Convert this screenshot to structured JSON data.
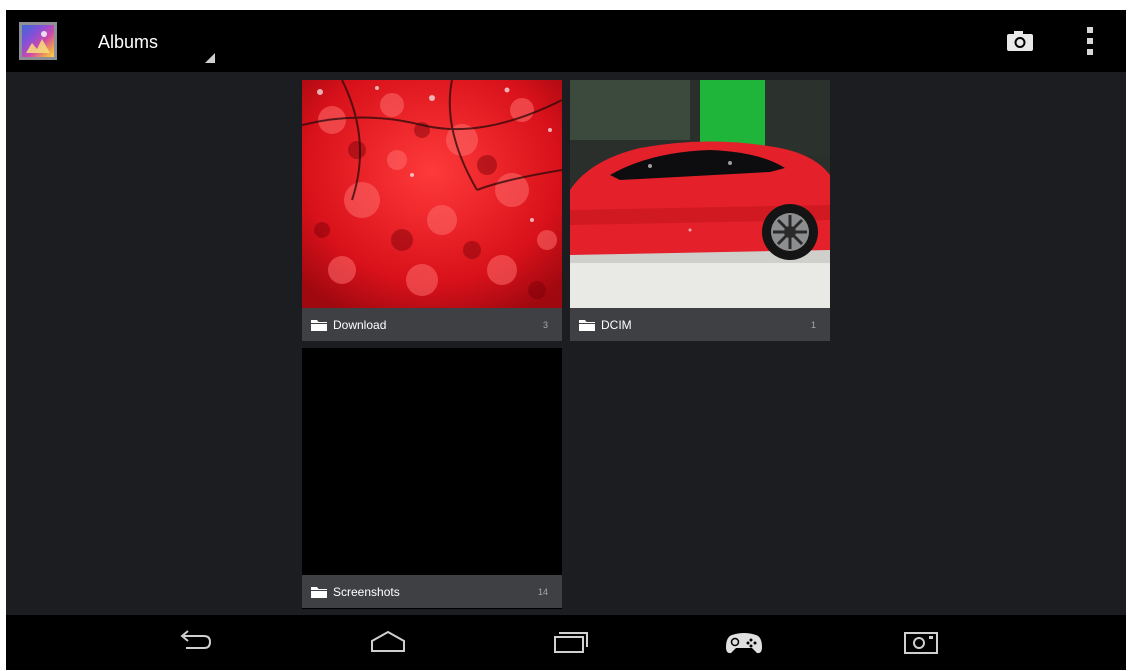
{
  "action_bar": {
    "title": "Albums",
    "icons": {
      "app": "gallery-app-icon",
      "spinner": "dropdown-indicator-icon",
      "camera": "camera-icon",
      "overflow": "overflow-menu-icon"
    }
  },
  "albums": [
    {
      "name": "Download",
      "count": "3",
      "icon": "folder-icon"
    },
    {
      "name": "DCIM",
      "count": "1",
      "icon": "folder-icon"
    },
    {
      "name": "Screenshots",
      "count": "14",
      "icon": "folder-icon"
    }
  ],
  "nav_bar": {
    "icons": [
      "back-icon",
      "home-icon",
      "recent-apps-icon",
      "gamepad-icon",
      "screenshot-icon"
    ]
  },
  "colors": {
    "background": "#1b1d20",
    "bars": "#000000",
    "label_bar": "#3e4044",
    "text": "#ffffff",
    "count_text": "#a8a8a8"
  }
}
